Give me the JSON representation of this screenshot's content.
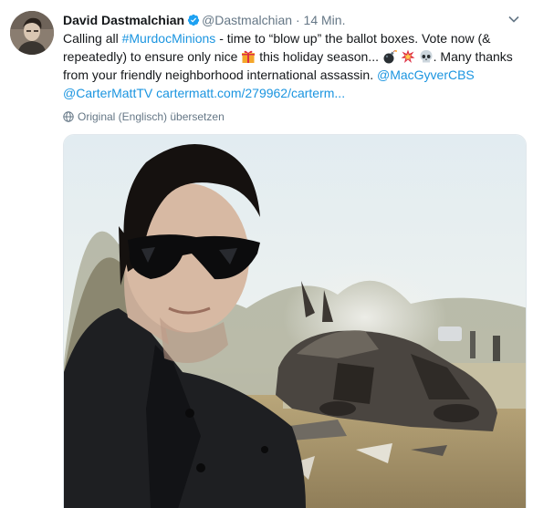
{
  "tweet": {
    "display_name": "David Dastmalchian",
    "handle": "@Dastmalchian",
    "separator": "·",
    "time": "14 Min.",
    "text_parts": {
      "p1": "Calling all ",
      "hashtag": "#MurdocMinions",
      "p2": " - time to “blow up” the ballot boxes. Vote now (& repeatedly) to ensure only nice ",
      "p3": " this holiday season... ",
      "p4": ". Many thanks from your friendly neighborhood international assassin.  ",
      "mention1": "@MacGyverCBS",
      "mention2": "@CarterMattTV",
      "url": "cartermatt.com/279962/carterm..."
    },
    "translate_label": "Original (Englisch) übersetzen"
  },
  "icons": {
    "verified": "verified-badge-icon",
    "caret": "chevron-down-icon",
    "globe": "globe-icon",
    "emoji1": "wrapped-gift-emoji",
    "emoji2": "bomb-emoji",
    "emoji3": "collision-emoji",
    "emoji4": "skull-emoji"
  },
  "colors": {
    "link": "#1b95e0",
    "verified": "#1da1f2",
    "text": "#14171a",
    "secondary": "#657786"
  }
}
